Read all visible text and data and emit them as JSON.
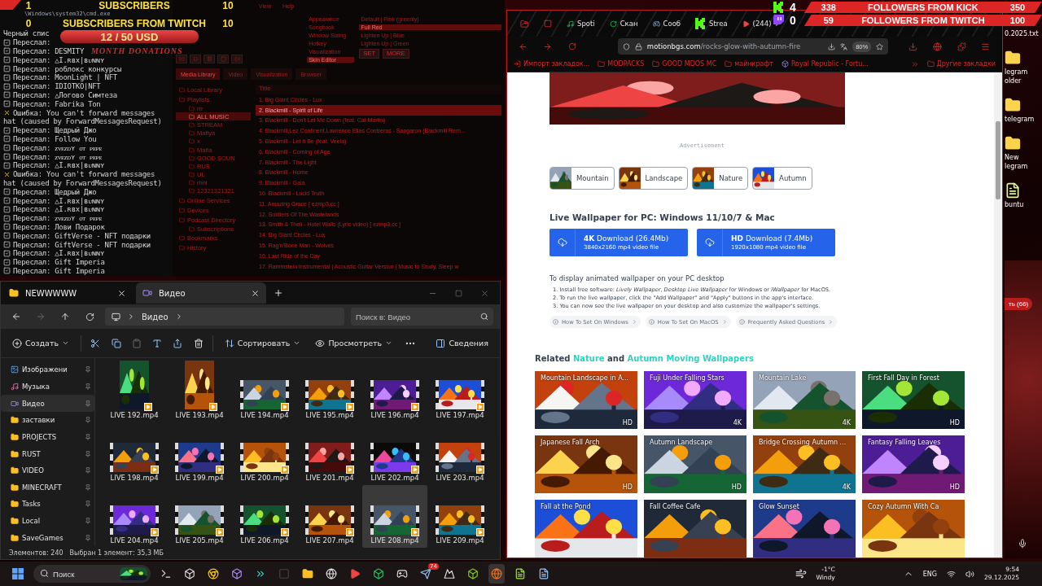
{
  "overlay_subs": [
    {
      "count": "1",
      "label": "SUBSCRIBERS",
      "goal": "10"
    },
    {
      "count": "0",
      "label": "SUBSCRIBERS FROM TWITCH",
      "goal": "10"
    }
  ],
  "donations": {
    "amount": "12 / 50 USD",
    "label": "MONTH DONATIONS"
  },
  "followers": [
    {
      "kind": "kick",
      "count": "4",
      "current": "338",
      "label": "FOLLOWERS FROM KICK",
      "goal": "350"
    },
    {
      "kind": "twitch",
      "count": "0",
      "current": "59",
      "label": "FOLLOWERS FROM TWITCH",
      "goal": "100"
    }
  ],
  "terminal": {
    "title": "\\Windows\\system32\\cmd.exe",
    "lines": [
      {
        "kind": "plain",
        "text": "Черный спис"
      },
      {
        "kind": "ok",
        "text": "Переслал:"
      },
      {
        "kind": "ok",
        "text": "Переслал: DESMITY"
      },
      {
        "kind": "ok",
        "text": "Переслал: △I.ʀʙx|ʙᴜɴɴʏ"
      },
      {
        "kind": "ok",
        "text": "Переслал: роблокс конкурсы"
      },
      {
        "kind": "ok",
        "text": "Переслал: MoonLight | NFT"
      },
      {
        "kind": "ok",
        "text": "Переслал: IDIOTKO|NFT"
      },
      {
        "kind": "ok",
        "text": "Переслал: △Логово Симтеза"
      },
      {
        "kind": "ok",
        "text": "Переслал: Fabrika Ton"
      },
      {
        "kind": "error",
        "text": "Ошибка: You can't forward messages"
      },
      {
        "kind": "plain",
        "text": "hat (caused by ForwardMessagesRequest)"
      },
      {
        "kind": "ok",
        "text": "Переслал: Щедрый Джо"
      },
      {
        "kind": "ok",
        "text": "Переслал: Follow You"
      },
      {
        "kind": "ok",
        "text": "Переслал: ᴢᴠᴇᴢᴅʏ ᴏᴛ ᴘᴇᴘᴇ"
      },
      {
        "kind": "ok",
        "text": "Переслал: ᴢᴠᴇᴢᴅʏ ᴏᴛ ᴘᴇᴘᴇ"
      },
      {
        "kind": "ok",
        "text": "Переслал: △I.ʀʙx|ʙᴜɴɴʏ"
      },
      {
        "kind": "error",
        "text": "Ошибка: You can't forward messages"
      },
      {
        "kind": "plain",
        "text": "hat (caused by ForwardMessagesRequest)"
      },
      {
        "kind": "ok",
        "text": "Переслал: Щедрый Джо"
      },
      {
        "kind": "ok",
        "text": "Переслал: △I.ʀʙx|ʙᴜɴɴʏ"
      },
      {
        "kind": "ok",
        "text": "Переслал: △I.ʀʙx|ʙᴜɴɴʏ"
      },
      {
        "kind": "ok",
        "text": "Переслал: ᴢᴠᴇᴢᴅʏ ᴏᴛ ᴘᴇᴘᴇ"
      },
      {
        "kind": "ok",
        "text": "Переслал: Лови Подарок"
      },
      {
        "kind": "ok",
        "text": "Переслал: GiftVerse - NFT подарки"
      },
      {
        "kind": "ok",
        "text": "Переслал: GiftVerse - NFT подарки"
      },
      {
        "kind": "ok",
        "text": "Переслал: △I.ʀʙx|ʙᴜɴɴʏ"
      },
      {
        "kind": "ok",
        "text": "Переслал: Gift Imperia"
      },
      {
        "kind": "ok",
        "text": "Переслал: Gift Imperia"
      }
    ]
  },
  "player": {
    "menu": [
      "View",
      "Help"
    ],
    "settings": [
      {
        "label": "Appearance",
        "selected": false
      },
      {
        "label": "Songbook",
        "selected": false
      },
      {
        "label": "Window Sizing",
        "selected": false
      },
      {
        "label": "Hotkey",
        "selected": false
      },
      {
        "label": "Visualization",
        "selected": false
      },
      {
        "label": "Skin Editor",
        "selected": true
      }
    ],
    "skins": [
      {
        "label": "Default | Pink (greenly)",
        "selected": false
      },
      {
        "label": "Full Red",
        "selected": true
      },
      {
        "label": "Lighten Up | Blue",
        "selected": false
      },
      {
        "label": "Lighten Up | Green",
        "selected": false
      }
    ],
    "skin_buttons": [
      "SET",
      "MORE"
    ],
    "tabs": [
      {
        "label": "Media Library",
        "selected": true
      },
      {
        "label": "Video",
        "selected": false
      },
      {
        "label": "Visualization",
        "selected": false
      },
      {
        "label": "Browser",
        "selected": false
      }
    ],
    "tree": [
      {
        "label": "Local Library",
        "selected": false
      },
      {
        "label": "Playlists",
        "selected": false,
        "children": [
          {
            "label": "rrr",
            "selected": false
          },
          {
            "label": "ALL MUSIC",
            "selected": true
          },
          {
            "label": "STREAM",
            "selected": false
          },
          {
            "label": "Mafiya",
            "selected": false
          },
          {
            "label": "x",
            "selected": false
          },
          {
            "label": "Mafia",
            "selected": false
          },
          {
            "label": "GOOD SOUN",
            "selected": false
          },
          {
            "label": "RUS",
            "selected": false
          },
          {
            "label": "UL",
            "selected": false
          },
          {
            "label": "rhnl",
            "selected": false
          },
          {
            "label": "12321321321",
            "selected": false
          }
        ]
      },
      {
        "label": "Online Services",
        "selected": false
      },
      {
        "label": "Devices",
        "selected": false
      },
      {
        "label": "Podcast Directory",
        "selected": false,
        "children": [
          {
            "label": "Subscriptions",
            "selected": false
          }
        ]
      },
      {
        "label": "Bookmarks",
        "selected": false
      },
      {
        "label": "History",
        "selected": false
      }
    ],
    "column": "Title",
    "tracks": [
      {
        "title": "1. Big Giant Circles - Lux",
        "selected": false
      },
      {
        "title": "2. Blackmill - Spirit of Life",
        "selected": true
      },
      {
        "title": "3. Blackmill - Don't Let Me Down (feat. Cat Martin)",
        "selected": false
      },
      {
        "title": "4. Blackmill,Lez Continent,Lawrence Elias Contreras - Sangaron (Blackmill Rem...",
        "selected": false
      },
      {
        "title": "5. Blackmill - Let It Be (feat. Veela)",
        "selected": false
      },
      {
        "title": "6. Blackmill - Coming of Age",
        "selected": false
      },
      {
        "title": "7. Blackmill - The Light",
        "selected": false
      },
      {
        "title": "8. Blackmill - Home",
        "selected": false
      },
      {
        "title": "9. Blackmill - Gaia",
        "selected": false
      },
      {
        "title": "10. Blackmill - Lucid Truth",
        "selected": false
      },
      {
        "title": "11. Amazing Grace [ ezmp3.cc ]",
        "selected": false
      },
      {
        "title": "12. Soldiers Of The Wastelands",
        "selected": false
      },
      {
        "title": "13. Smith & Thell - Hotel Walls (Lyric video) [ ezmp3.cc ]",
        "selected": false
      },
      {
        "title": "14. Big Giant Circles - Lux",
        "selected": false
      },
      {
        "title": "15. Rag'n'Bone Man - Wolves",
        "selected": false
      },
      {
        "title": "16. Last Ride of the Day",
        "selected": false
      },
      {
        "title": "17. Rammstein Instrumental | Acoustic Guitar Version | Music to Study, Sleep w",
        "selected": false
      }
    ]
  },
  "explorer": {
    "tabs": [
      {
        "label": "NEWWWWW",
        "selected": false
      },
      {
        "label": "Видео",
        "selected": true
      }
    ],
    "path": "Видео",
    "search": {
      "placeholder": "Поиск в: Видео"
    },
    "toolbar": {
      "create": "Создать",
      "sort": "Сортировать",
      "view": "Просмотреть",
      "details": "Сведения"
    },
    "sidebar": [
      {
        "label": "Изображени",
        "kind": "pictures",
        "selected": false
      },
      {
        "label": "Музыка",
        "kind": "music",
        "selected": false
      },
      {
        "label": "Видео",
        "kind": "video",
        "selected": true
      },
      {
        "label": "заставки",
        "kind": "folder",
        "selected": false
      },
      {
        "label": "PROJECTS",
        "kind": "folder",
        "selected": false
      },
      {
        "label": "RUST",
        "kind": "folder",
        "selected": false
      },
      {
        "label": "VIDEO",
        "kind": "folder",
        "selected": false
      },
      {
        "label": "MINECRAFT",
        "kind": "folder",
        "selected": false
      },
      {
        "label": "Tasks",
        "kind": "folder",
        "selected": false
      },
      {
        "label": "Local",
        "kind": "folder",
        "selected": false
      },
      {
        "label": "SaveGames",
        "kind": "folder",
        "selected": false
      }
    ],
    "files": [
      {
        "name": "LIVE 192.mp4",
        "kind": "portrait",
        "selected": false
      },
      {
        "name": "LIVE 193.mp4",
        "kind": "portrait",
        "selected": false
      },
      {
        "name": "LIVE 194.mp4",
        "kind": "film",
        "selected": false
      },
      {
        "name": "LIVE 195.mp4",
        "kind": "film",
        "selected": false
      },
      {
        "name": "LIVE 196.mp4",
        "kind": "film",
        "selected": false
      },
      {
        "name": "LIVE 197.mp4",
        "kind": "film",
        "selected": false
      },
      {
        "name": "LIVE 198.mp4",
        "kind": "film",
        "selected": false
      },
      {
        "name": "LIVE 199.mp4",
        "kind": "film",
        "selected": false
      },
      {
        "name": "LIVE 200.mp4",
        "kind": "film",
        "selected": false
      },
      {
        "name": "LIVE 201.mp4",
        "kind": "film",
        "selected": false
      },
      {
        "name": "LIVE 202.mp4",
        "kind": "film",
        "selected": false
      },
      {
        "name": "LIVE 203.mp4",
        "kind": "film",
        "selected": false
      },
      {
        "name": "LIVE 204.mp4",
        "kind": "film",
        "selected": false
      },
      {
        "name": "LIVE 205.mp4",
        "kind": "film",
        "selected": false
      },
      {
        "name": "LIVE 206.mp4",
        "kind": "film",
        "selected": false
      },
      {
        "name": "LIVE 207.mp4",
        "kind": "film",
        "selected": false
      },
      {
        "name": "LIVE 208.mp4",
        "kind": "film",
        "selected": true
      },
      {
        "name": "LIVE 209.mp4",
        "kind": "film",
        "selected": false
      }
    ],
    "status": [
      "Элементов: 240",
      "Выбран 1 элемент: 35,3 МБ"
    ]
  },
  "browser": {
    "tabs": [
      {
        "label": "Spoti",
        "kind": "music"
      },
      {
        "label": "Скан",
        "kind": "scan"
      },
      {
        "label": "Сооб",
        "kind": "steam"
      },
      {
        "label": "Strea",
        "kind": "kick"
      },
      {
        "label": "(244)",
        "kind": "video"
      }
    ],
    "url": {
      "host": "motionbgs.com",
      "path": "/rocks-glow-with-autumn-fire"
    },
    "zoom": "80%",
    "bookmarks": [
      {
        "label": "Импорт закладок...",
        "kind": "import"
      },
      {
        "label": "MODPACKS",
        "kind": "folder"
      },
      {
        "label": "GOOD MDOS MC",
        "kind": "folder"
      },
      {
        "label": "майнкрафт",
        "kind": "folder"
      },
      {
        "label": "Royal Republic - Fortu...",
        "kind": "site"
      }
    ],
    "other_bookmarks": "Другие закладки",
    "page": {
      "ad": "Advertisement",
      "chips": [
        "Mountain",
        "Landscape",
        "Nature",
        "Autumn"
      ],
      "heading": "Live Wallpaper for PC: Windows 11/10/7 & Mac",
      "downloads": [
        {
          "title": "**4K** Download (26.4Mb)",
          "sub": "3840x2160 mp4 video file"
        },
        {
          "title": "**HD** Download (7.4Mb)",
          "sub": "1920x1080 mp4 video file"
        }
      ],
      "intro": "To display animated wallpaper on your PC desktop",
      "steps": [
        "1. Install free software: *Lively Wallpaper*, *Desktop Live Wallpaper* for Windows or *iWallpaper* for MacOS.",
        "2. To run the live wallpaper, click the \"Add Wallpaper\" and \"Apply\" buttons in the app's interface.",
        "3. You can now see the live wallpaper on your desktop and also customize the wallpaper's settings."
      ],
      "guides": [
        "How To Set On Windows",
        "How To Set On MacOS",
        "Frequently Asked Questions"
      ],
      "related": [
        {
          "text": "Related",
          "kind": "plain"
        },
        {
          "text": "Nature",
          "kind": "link"
        },
        {
          "text": "and",
          "kind": "plain"
        },
        {
          "text": "Autumn Moving Wallpapers",
          "kind": "link"
        }
      ],
      "wallpapers": [
        {
          "title": "Mountain Landscape in A...",
          "badge": "HD"
        },
        {
          "title": "Fuji Under Falling Stars",
          "badge": "4K"
        },
        {
          "title": "Mountain Lake",
          "badge": "4K"
        },
        {
          "title": "First Fall Day in Forest",
          "badge": "HD"
        },
        {
          "title": "Japanese Fall Arch",
          "badge": "HD"
        },
        {
          "title": "Autumn Landscape",
          "badge": "HD"
        },
        {
          "title": "Bridge Crossing Autumn ...",
          "badge": "4K"
        },
        {
          "title": "Fantasy Falling Leaves",
          "badge": "HD"
        },
        {
          "title": "Fall at the Pond"
        },
        {
          "title": "Fall Coffee Cafe"
        },
        {
          "title": "Glow Sunset"
        },
        {
          "title": "Cozy Autumn With Ca"
        }
      ]
    }
  },
  "desktop": {
    "file": "0.2025.txt",
    "icons": [
      "legram older",
      "telegram",
      "New legram",
      "buntu"
    ],
    "window_badge": "ть (66)"
  },
  "taskbar": {
    "search": {
      "placeholder": "Поиск"
    },
    "badge": "74",
    "weather": {
      "temp": "-1°C",
      "desc": "Windy"
    },
    "lang": "ENG",
    "time": "9:54",
    "date": "29.12.2025"
  }
}
